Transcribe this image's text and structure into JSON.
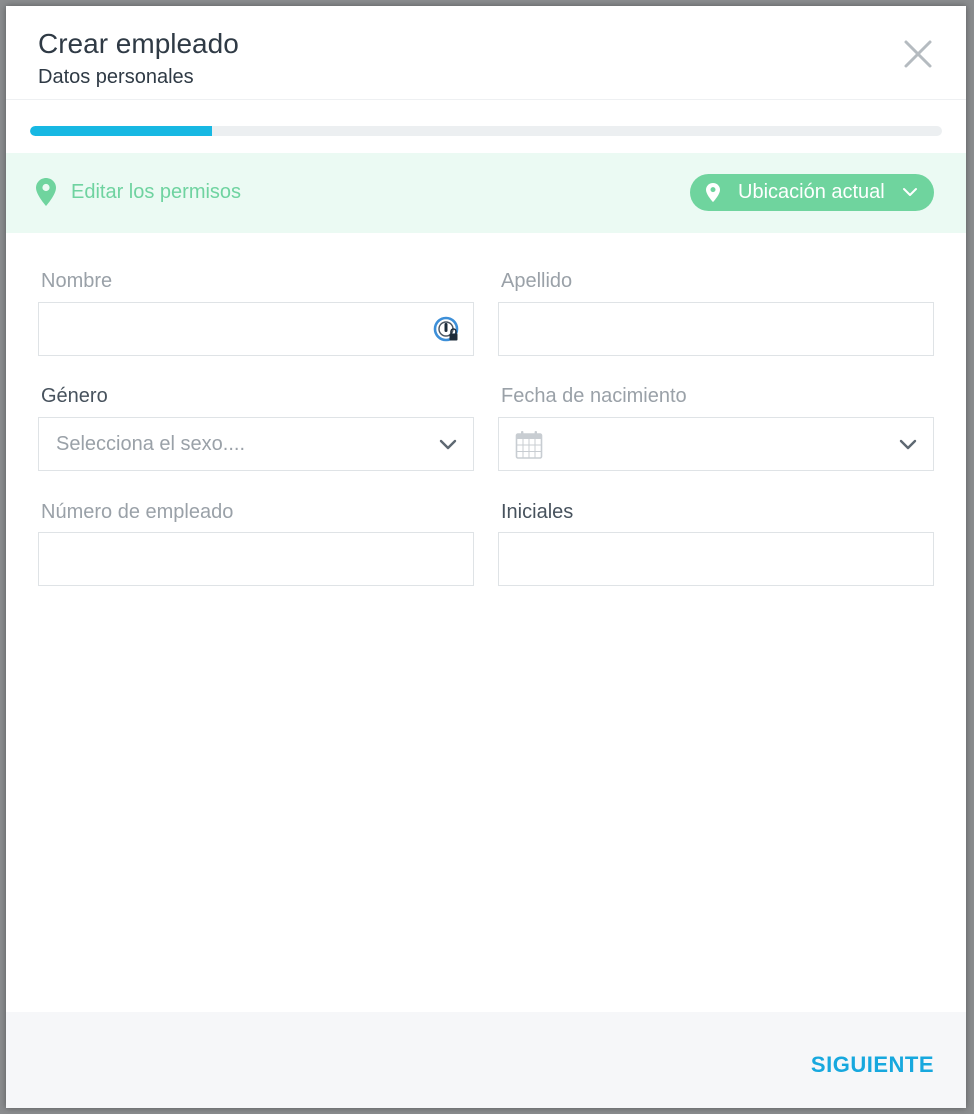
{
  "modal": {
    "title": "Crear empleado",
    "subtitle": "Datos personales",
    "close_icon": "close-icon"
  },
  "progress": {
    "value_fraction": 0.2,
    "color": "#17b8e3"
  },
  "location": {
    "label": "Editar los permisos",
    "dropdown_label": "Ubicación actual",
    "accent": "#6fd49e"
  },
  "form": {
    "first_name": {
      "label": "Nombre",
      "value": "",
      "icon": "password-manager-icon"
    },
    "last_name": {
      "label": "Apellido",
      "value": ""
    },
    "gender": {
      "label": "Género",
      "placeholder": "Selecciona el sexo...."
    },
    "birth_date": {
      "label": "Fecha de nacimiento",
      "icon": "calendar-icon"
    },
    "employee_number": {
      "label": "Número de empleado",
      "value": ""
    },
    "initials": {
      "label": "Iniciales",
      "value": ""
    }
  },
  "footer": {
    "next_label": "SIGUIENTE",
    "accent": "#17a8de"
  }
}
